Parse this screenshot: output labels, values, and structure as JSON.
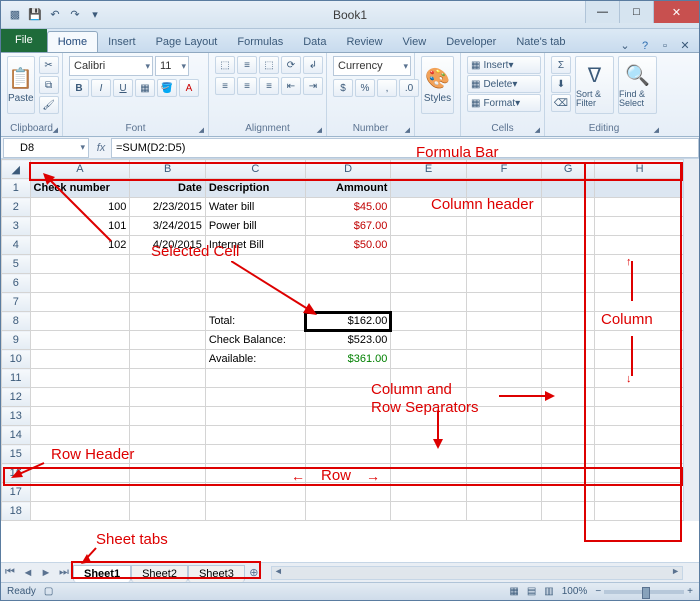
{
  "window": {
    "title": "Book1"
  },
  "qat": {
    "save": "💾",
    "undo": "↶",
    "redo": "↷",
    "more": "▾"
  },
  "tabs": {
    "file": "File",
    "items": [
      "Home",
      "Insert",
      "Page Layout",
      "Formulas",
      "Data",
      "Review",
      "View",
      "Developer",
      "Nate's tab"
    ],
    "active_index": 0
  },
  "ribbon": {
    "clipboard": {
      "label": "Clipboard",
      "paste": "Paste"
    },
    "font": {
      "label": "Font",
      "name": "Calibri",
      "size": "11"
    },
    "alignment": {
      "label": "Alignment"
    },
    "number": {
      "label": "Number",
      "format": "Currency"
    },
    "styles": {
      "label": "Styles",
      "btn": "Styles"
    },
    "cells": {
      "label": "Cells",
      "insert": "Insert",
      "delete": "Delete",
      "format": "Format"
    },
    "editing": {
      "label": "Editing",
      "sort": "Sort & Filter",
      "find": "Find & Select"
    }
  },
  "formula_bar": {
    "name_box": "D8",
    "fx": "fx",
    "formula": "=SUM(D2:D5)"
  },
  "columns": [
    "A",
    "B",
    "C",
    "D",
    "E",
    "F",
    "G",
    "H"
  ],
  "rows": [
    "1",
    "2",
    "3",
    "4",
    "5",
    "6",
    "7",
    "8",
    "9",
    "10",
    "11",
    "12",
    "13",
    "14",
    "15",
    "16",
    "17",
    "18"
  ],
  "headers": {
    "A": "Check number",
    "B": "Date",
    "C": "Description",
    "D": "Ammount"
  },
  "data_rows": [
    {
      "A": "100",
      "B": "2/23/2015",
      "C": "Water bill",
      "D": "$45.00"
    },
    {
      "A": "101",
      "B": "3/24/2015",
      "C": "Power bill",
      "D": "$67.00"
    },
    {
      "A": "102",
      "B": "4/20/2015",
      "C": "Internet Bill",
      "D": "$50.00"
    }
  ],
  "totals": [
    {
      "C": "Total:",
      "D": "$162.00",
      "row": 8
    },
    {
      "C": "Check Balance:",
      "D": "$523.00",
      "row": 9
    },
    {
      "C": "Available:",
      "D": "$361.00",
      "row": 10
    }
  ],
  "sheets": {
    "items": [
      "Sheet1",
      "Sheet2",
      "Sheet3"
    ],
    "active_index": 0
  },
  "status": {
    "ready": "Ready",
    "zoom": "100%"
  },
  "annotations": {
    "formula_bar": "Formula Bar",
    "column_header": "Column header",
    "selected_cell": "Selected Cell",
    "column": "Column",
    "col_row_sep": "Column and\nRow Separators",
    "row_header": "Row Header",
    "row": "Row",
    "sheet_tabs": "Sheet tabs"
  },
  "chart_data": {
    "type": "table",
    "title": "Book1",
    "columns": [
      "Check number",
      "Date",
      "Description",
      "Ammount"
    ],
    "rows": [
      [
        100,
        "2/23/2015",
        "Water bill",
        45.0
      ],
      [
        101,
        "3/24/2015",
        "Power bill",
        67.0
      ],
      [
        102,
        "4/20/2015",
        "Internet Bill",
        50.0
      ]
    ],
    "summary": {
      "Total": 162.0,
      "Check Balance": 523.0,
      "Available": 361.0
    },
    "selected_cell": "D8",
    "formula": "=SUM(D2:D5)"
  }
}
